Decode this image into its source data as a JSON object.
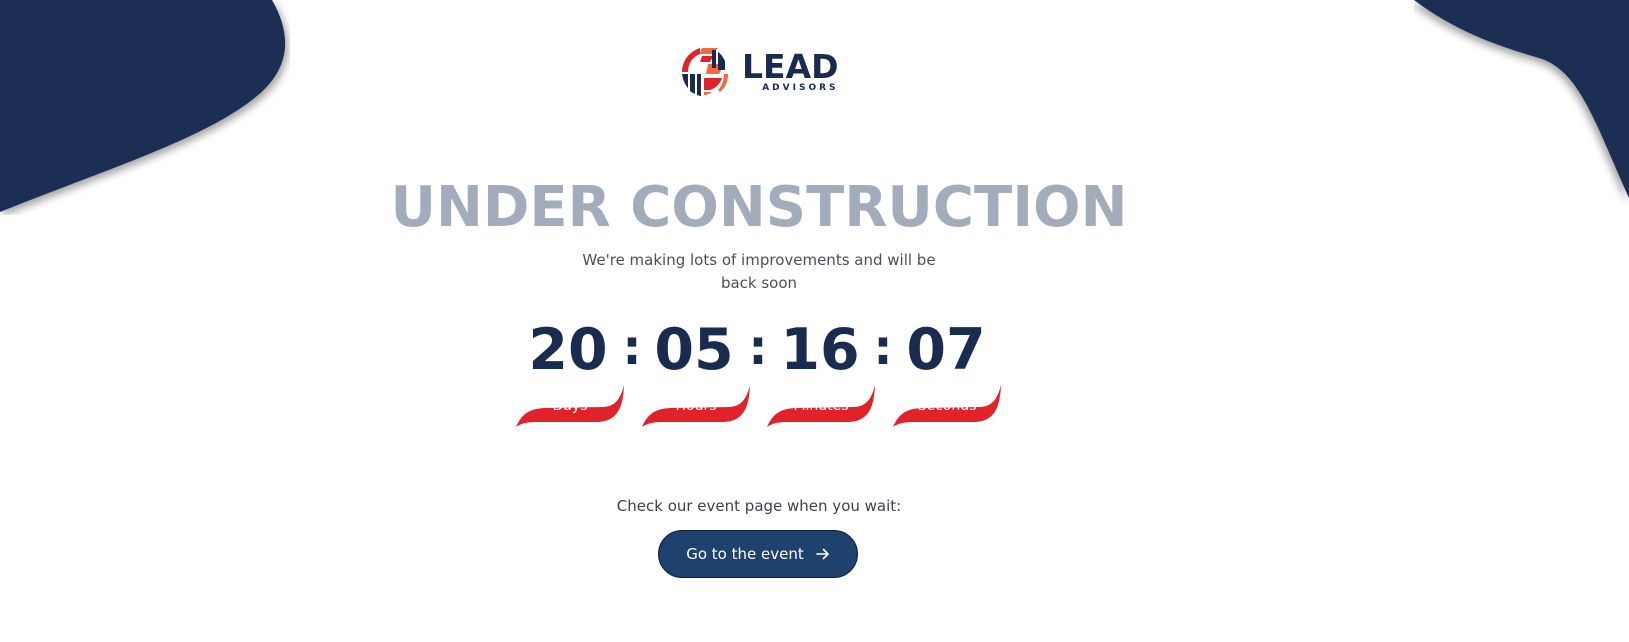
{
  "brand": {
    "name": "LEAD",
    "tagline": "ADVISORS"
  },
  "main": {
    "title": "UNDER CONSTRUCTION",
    "subtitle": "We're making lots of improvements and will be back soon"
  },
  "countdown": {
    "separator": ":",
    "units": [
      {
        "value": "20",
        "label": "Days"
      },
      {
        "value": "05",
        "label": "Hours"
      },
      {
        "value": "16",
        "label": "Minutes"
      },
      {
        "value": "07",
        "label": "Seconds"
      }
    ]
  },
  "cta": {
    "text": "Check our event page when you wait:",
    "button_label": "Go to the event",
    "button_icon": "arrow-right-icon"
  },
  "colors": {
    "navy": "#1a2b50",
    "red": "#e2222a",
    "title_gray": "#a3acba",
    "button": "#1f416e"
  }
}
